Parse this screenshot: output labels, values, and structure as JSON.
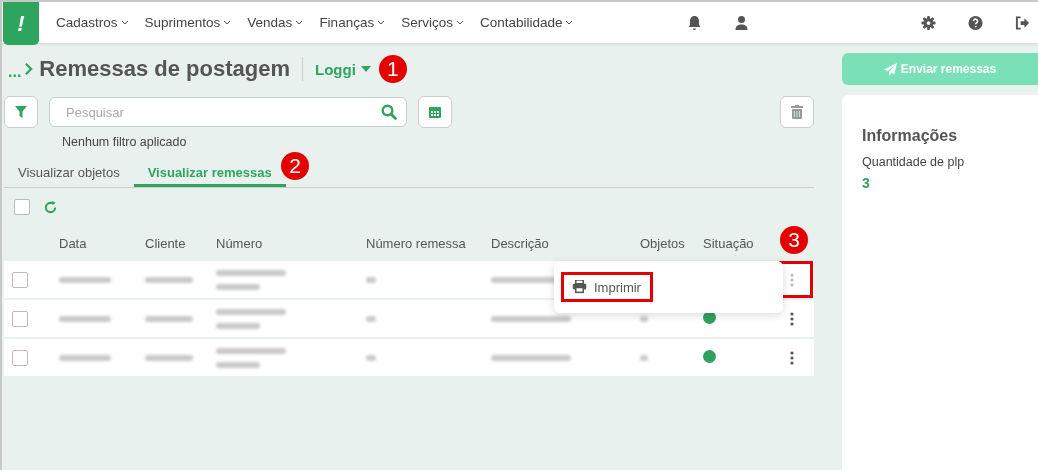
{
  "nav": {
    "logo": "!",
    "menus": [
      {
        "label": "Cadastros"
      },
      {
        "label": "Suprimentos"
      },
      {
        "label": "Vendas"
      },
      {
        "label": "Finanças"
      },
      {
        "label": "Serviços"
      },
      {
        "label": "Contabilidade"
      }
    ]
  },
  "breadcrumb": {
    "ellipsis": "...",
    "title": "Remessas de postagem",
    "carrier": "Loggi"
  },
  "search": {
    "placeholder": "Pesquisar",
    "filter_status": "Nenhum filtro aplicado"
  },
  "tabs": [
    {
      "label": "Visualizar objetos",
      "selected": false
    },
    {
      "label": "Visualizar remessas",
      "selected": true
    }
  ],
  "table": {
    "select_all": {
      "checked": false
    },
    "columns": [
      "Data",
      "Cliente",
      "Número",
      "Número remessa",
      "Descrição",
      "Objetos",
      "Situação"
    ],
    "rows": [
      {
        "checked": false,
        "menu_open": true
      },
      {
        "checked": false,
        "menu_open": false,
        "color": "#31a05f"
      },
      {
        "checked": false,
        "menu_open": false,
        "color": "#31a05f"
      }
    ]
  },
  "row_menu": {
    "items": [
      "Imprimir"
    ]
  },
  "side": {
    "send_button": "Enviar remessas",
    "title": "Informações",
    "label": "Quantidade de plp",
    "value": "3"
  },
  "callouts": [
    "1",
    "2",
    "3"
  ]
}
